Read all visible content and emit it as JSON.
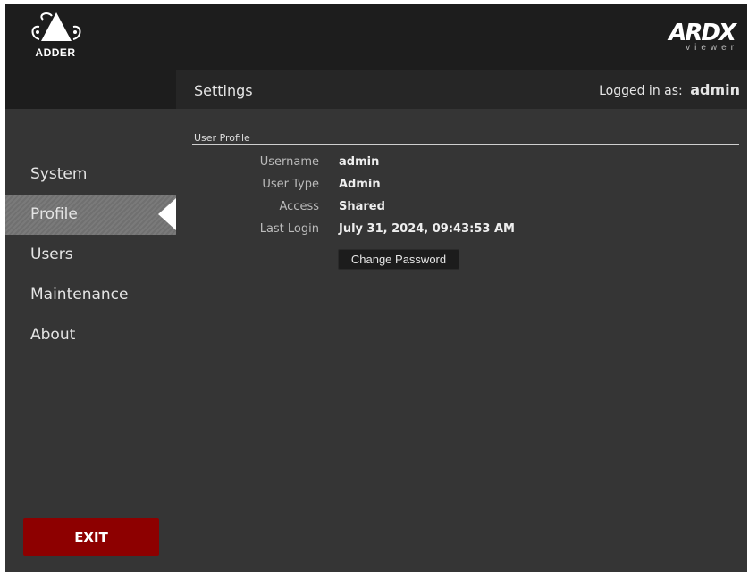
{
  "brand": {
    "left_logo_text": "ADDER",
    "right_logo_text": "ARDX",
    "right_logo_subtext": "viewer"
  },
  "header": {
    "title": "Settings",
    "logged_in_label": "Logged in as:",
    "logged_in_user": "admin"
  },
  "sidebar": {
    "items": [
      {
        "label": "System",
        "active": false
      },
      {
        "label": "Profile",
        "active": true
      },
      {
        "label": "Users",
        "active": false
      },
      {
        "label": "Maintenance",
        "active": false
      },
      {
        "label": "About",
        "active": false
      }
    ],
    "exit_label": "EXIT"
  },
  "profile": {
    "section_title": "User Profile",
    "fields": [
      {
        "label": "Username",
        "value": "admin"
      },
      {
        "label": "User Type",
        "value": "Admin"
      },
      {
        "label": "Access",
        "value": "Shared"
      },
      {
        "label": "Last Login",
        "value": "July 31, 2024, 09:43:53 AM"
      }
    ],
    "change_password_label": "Change Password"
  },
  "colors": {
    "exit_button": "#8d0000",
    "panel_background": "#353535",
    "header_background": "#262626"
  }
}
